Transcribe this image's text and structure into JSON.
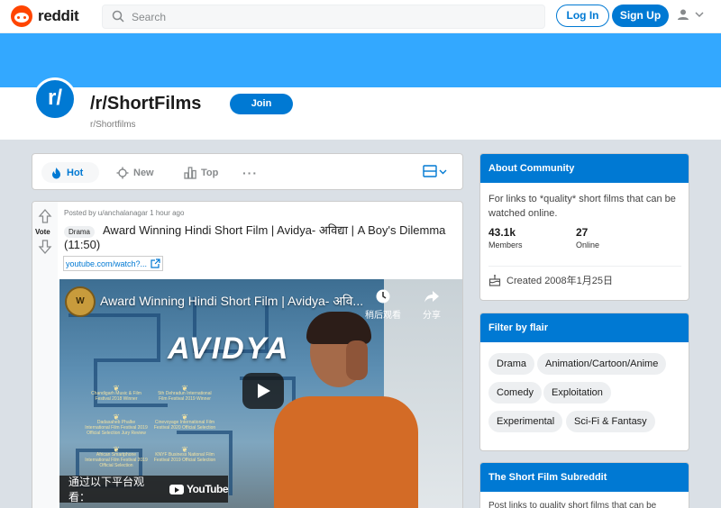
{
  "header": {
    "logo_text": "reddit",
    "search_placeholder": "Search",
    "login_label": "Log In",
    "signup_label": "Sign Up"
  },
  "subreddit": {
    "avatar_text": "r/",
    "title": "/r/ShortFilms",
    "name": "r/Shortfilms",
    "join_label": "Join"
  },
  "sort": {
    "hot": "Hot",
    "new": "New",
    "top": "Top",
    "more": "···"
  },
  "post": {
    "vote_label": "Vote",
    "meta": "Posted by u/anchalanagar 1 hour ago",
    "flair": "Drama",
    "title": "Award Winning Hindi Short Film | Avidya- अविद्या | A Boy's Dilemma (11:50)",
    "link": "youtube.com/watch?...",
    "video": {
      "title": "Award Winning Hindi Short Film | Avidya- अवि...",
      "channel_badge": "W",
      "watch_later": "稍后观看",
      "share": "分享",
      "movie_title": "AVIDYA",
      "laurels": [
        "Chandigarh Music & Film Festival 2018 Winner",
        "5th Dehradun International Film Festival 2019 Winner",
        "Dadasaheb Phalke International Film Festival 2019 Official Selection Jury Review",
        "Cinevoyage International Film Festival 2020 Official Selection",
        "African Smartphone International Film Festival 2019 Official Selection",
        "KNYF Business National Film Festival 2019 Official Selection"
      ],
      "watch_on": "通过以下平台观看：",
      "youtube": "YouTube"
    }
  },
  "about": {
    "heading": "About Community",
    "description": "For links to *quality* short films that can be watched online.",
    "members_value": "43.1k",
    "members_label": "Members",
    "online_value": "27",
    "online_label": "Online",
    "created": "Created 2008年1月25日"
  },
  "flair": {
    "heading": "Filter by flair",
    "chips": [
      "Drama",
      "Animation/Cartoon/Anime",
      "Comedy",
      "Exploitation",
      "Experimental",
      "Sci-Fi & Fantasy"
    ]
  },
  "short_widget": {
    "heading": "The Short Film Subreddit",
    "description": "Post links to quality short films that can be"
  },
  "colors": {
    "brand_orange": "#ff4500",
    "primary_blue": "#0079d3",
    "banner_blue": "#33a8ff",
    "page_bg": "#dae0e6"
  }
}
